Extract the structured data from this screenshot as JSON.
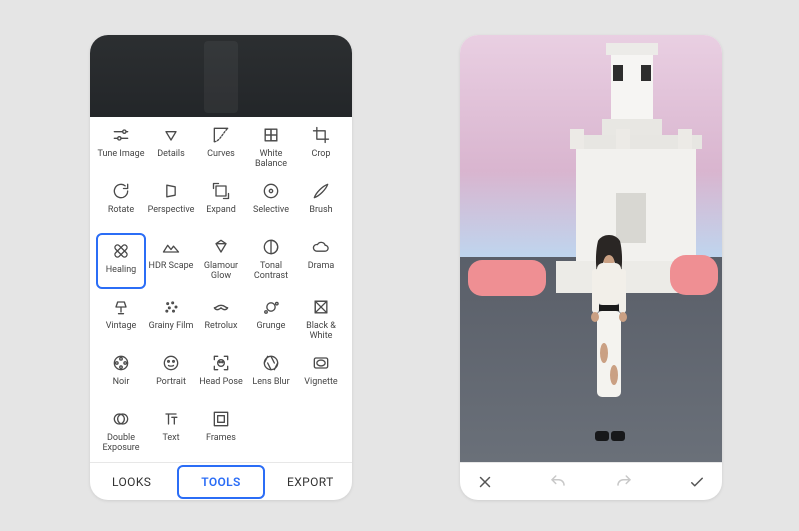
{
  "accent_color": "#2b6df6",
  "left_tabs": {
    "looks": "LOOKS",
    "tools": "TOOLS",
    "export": "EXPORT",
    "active": "tools"
  },
  "selected_tool": "healing",
  "tools": [
    {
      "id": "tune-image",
      "label": "Tune Image",
      "icon": "sliders-icon"
    },
    {
      "id": "details",
      "label": "Details",
      "icon": "triangle-down-icon"
    },
    {
      "id": "curves",
      "label": "Curves",
      "icon": "curves-icon"
    },
    {
      "id": "white-balance",
      "label": "White Balance",
      "icon": "checker-icon"
    },
    {
      "id": "crop",
      "label": "Crop",
      "icon": "crop-icon"
    },
    {
      "id": "rotate",
      "label": "Rotate",
      "icon": "rotate-icon"
    },
    {
      "id": "perspective",
      "label": "Perspective",
      "icon": "perspective-icon"
    },
    {
      "id": "expand",
      "label": "Expand",
      "icon": "expand-icon"
    },
    {
      "id": "selective",
      "label": "Selective",
      "icon": "target-circle-icon"
    },
    {
      "id": "brush",
      "label": "Brush",
      "icon": "brush-icon"
    },
    {
      "id": "healing",
      "label": "Healing",
      "icon": "bandage-icon"
    },
    {
      "id": "hdr-scape",
      "label": "HDR Scape",
      "icon": "mountains-icon"
    },
    {
      "id": "glamour-glow",
      "label": "Glamour Glow",
      "icon": "diamond-icon"
    },
    {
      "id": "tonal-contrast",
      "label": "Tonal Contrast",
      "icon": "half-circle-icon"
    },
    {
      "id": "drama",
      "label": "Drama",
      "icon": "cloud-icon"
    },
    {
      "id": "vintage",
      "label": "Vintage",
      "icon": "lamp-icon"
    },
    {
      "id": "grainy-film",
      "label": "Grainy Film",
      "icon": "grain-icon"
    },
    {
      "id": "retrolux",
      "label": "Retrolux",
      "icon": "mustache-icon"
    },
    {
      "id": "grunge",
      "label": "Grunge",
      "icon": "splat-icon"
    },
    {
      "id": "black-white",
      "label": "Black & White",
      "icon": "square-split-icon"
    },
    {
      "id": "noir",
      "label": "Noir",
      "icon": "film-reel-icon"
    },
    {
      "id": "portrait",
      "label": "Portrait",
      "icon": "face-icon"
    },
    {
      "id": "head-pose",
      "label": "Head Pose",
      "icon": "head-frame-icon"
    },
    {
      "id": "lens-blur",
      "label": "Lens Blur",
      "icon": "iris-icon"
    },
    {
      "id": "vignette",
      "label": "Vignette",
      "icon": "vignette-icon"
    },
    {
      "id": "double-exposure",
      "label": "Double Exposure",
      "icon": "double-exposure-icon"
    },
    {
      "id": "text",
      "label": "Text",
      "icon": "text-icon"
    },
    {
      "id": "frames",
      "label": "Frames",
      "icon": "frame-icon"
    }
  ],
  "right_actions": {
    "close": "close-icon",
    "undo": "undo-icon",
    "redo": "redo-icon",
    "apply": "check-icon"
  }
}
